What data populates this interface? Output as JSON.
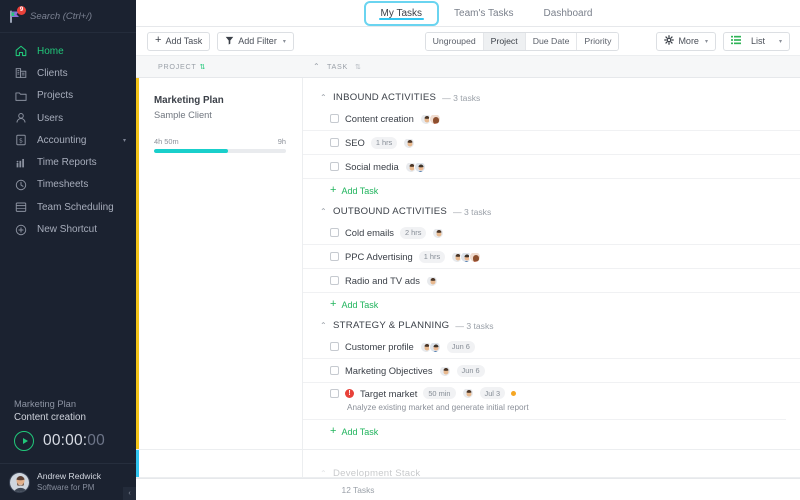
{
  "sidebar": {
    "search": {
      "placeholder": "Search (Ctrl+/)",
      "value": "",
      "badge": "9"
    },
    "items": [
      {
        "label": "Home",
        "icon": "home-icon"
      },
      {
        "label": "Clients",
        "icon": "clients-icon"
      },
      {
        "label": "Projects",
        "icon": "folder-icon"
      },
      {
        "label": "Users",
        "icon": "user-icon"
      },
      {
        "label": "Accounting",
        "icon": "accounting-icon",
        "caret": "▾"
      },
      {
        "label": "Time Reports",
        "icon": "bar-chart-icon"
      },
      {
        "label": "Timesheets",
        "icon": "clock-icon"
      },
      {
        "label": "Team Scheduling",
        "icon": "calendar-icon"
      },
      {
        "label": "New Shortcut",
        "icon": "plus-circle-icon"
      }
    ],
    "timer": {
      "project": "Marketing Plan",
      "task": "Content creation",
      "time_main": "00:00:",
      "time_seconds": "00"
    },
    "user": {
      "name": "Andrew Redwick",
      "role": "Software for PM"
    },
    "collapse_glyph": "‹"
  },
  "tabs": [
    {
      "label": "My Tasks",
      "active": true
    },
    {
      "label": "Team's Tasks",
      "active": false
    },
    {
      "label": "Dashboard",
      "active": false
    }
  ],
  "toolbar": {
    "add_task": "Add Task",
    "add_filter": "Add Filter",
    "group_options": [
      {
        "label": "Ungrouped",
        "active": false
      },
      {
        "label": "Project",
        "active": true
      },
      {
        "label": "Due Date",
        "active": false
      },
      {
        "label": "Priority",
        "active": false
      }
    ],
    "more": "More",
    "view": "List"
  },
  "columns": {
    "project": "Project",
    "task": "Task"
  },
  "project_row": {
    "accent_color": "#f5c518",
    "name": "Marketing Plan",
    "client": "Sample Client",
    "time_logged": "4h 50m",
    "time_total": "9h",
    "progress_pct": 56,
    "progress_color": "#19cfcb"
  },
  "sections": [
    {
      "title": "INBOUND ACTIVITIES",
      "count": "— 3 tasks",
      "tasks": [
        {
          "name": "Content creation",
          "duration": "",
          "date": "",
          "avatars": 2,
          "priority": false,
          "flag": false,
          "desc": ""
        },
        {
          "name": "SEO",
          "duration": "1 hrs",
          "date": "",
          "avatars": 1,
          "priority": false,
          "flag": false,
          "desc": ""
        },
        {
          "name": "Social media",
          "duration": "",
          "date": "",
          "avatars": 2,
          "priority": false,
          "flag": false,
          "desc": ""
        }
      ],
      "add_task": "Add Task"
    },
    {
      "title": "OUTBOUND ACTIVITIES",
      "count": "— 3 tasks",
      "tasks": [
        {
          "name": "Cold emails",
          "duration": "2 hrs",
          "date": "",
          "avatars": 1,
          "priority": false,
          "flag": false,
          "desc": ""
        },
        {
          "name": "PPC Advertising",
          "duration": "1 hrs",
          "date": "",
          "avatars": 3,
          "priority": false,
          "flag": false,
          "desc": ""
        },
        {
          "name": "Radio and TV ads",
          "duration": "",
          "date": "",
          "avatars": 1,
          "priority": false,
          "flag": false,
          "desc": ""
        }
      ],
      "add_task": "Add Task"
    },
    {
      "title": "STRATEGY & PLANNING",
      "count": "— 3 tasks",
      "tasks": [
        {
          "name": "Customer profile",
          "duration": "",
          "date": "Jun 6",
          "avatars": 2,
          "priority": false,
          "flag": false,
          "desc": ""
        },
        {
          "name": "Marketing Objectives",
          "duration": "",
          "date": "Jun 6",
          "avatars": 1,
          "priority": false,
          "flag": false,
          "desc": ""
        },
        {
          "name": "Target market",
          "duration": "50 min",
          "date": "Jul 3",
          "avatars": 1,
          "priority": true,
          "flag": true,
          "desc": "Analyze existing market and generate initial report"
        }
      ],
      "add_task": "Add Task"
    }
  ],
  "next_project_row": {
    "accent_color": "#31c5f0",
    "section_title": "Development Stack"
  },
  "footer": {
    "count": "12 Tasks"
  }
}
